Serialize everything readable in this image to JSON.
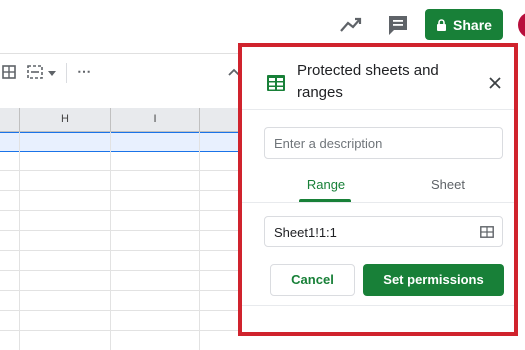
{
  "header": {
    "share_label": "Share",
    "icons": [
      "trending-icon",
      "comment-icon",
      "lock-icon"
    ]
  },
  "toolbar": {
    "more_label": "⋯",
    "icons": [
      "borders-icon",
      "merge-cells-icon",
      "chevron-down-icon",
      "collapse-up-icon"
    ]
  },
  "sheet": {
    "columns": [
      "",
      "H",
      "I",
      ""
    ]
  },
  "panel": {
    "title_line1": "Protected sheets and",
    "title_line2": "ranges",
    "description_placeholder": "Enter a description",
    "tabs": [
      {
        "label": "Range",
        "active": true
      },
      {
        "label": "Sheet",
        "active": false
      }
    ],
    "range_value": "Sheet1!1:1",
    "cancel_label": "Cancel",
    "set_permissions_label": "Set permissions"
  },
  "colors": {
    "accent_green": "#188038",
    "highlight_border": "#d0232d",
    "selection_fill": "#e8f0fe",
    "selection_border": "#1a73e8"
  }
}
